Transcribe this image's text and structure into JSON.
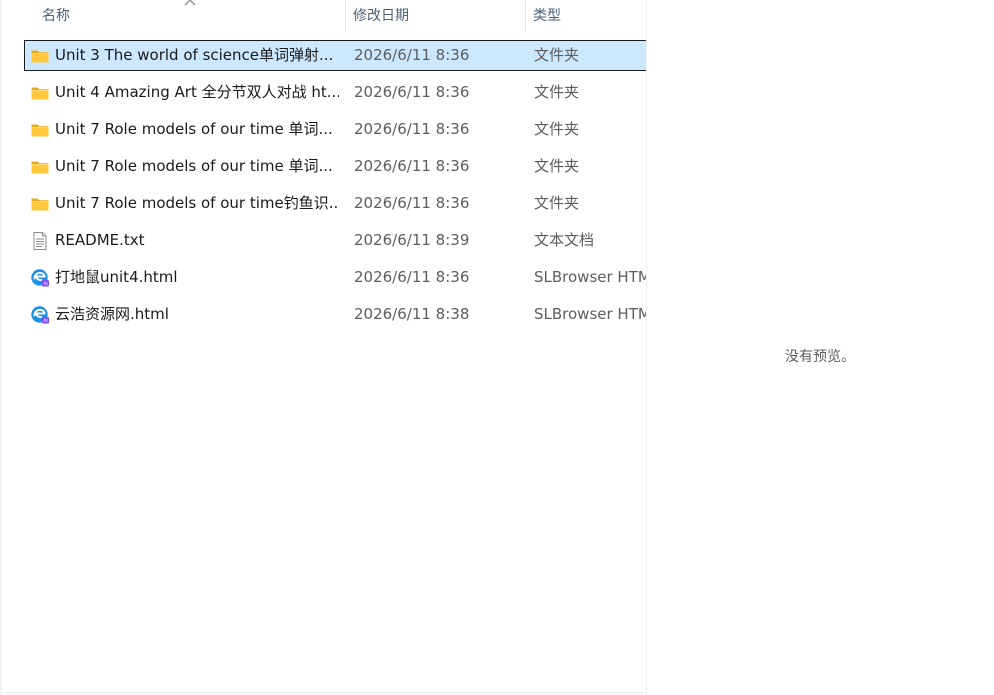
{
  "columns": {
    "name": "名称",
    "modified": "修改日期",
    "type": "类型"
  },
  "files": [
    {
      "name": "Unit 3 The world of science单词弹射...",
      "modified": "2026/6/11 8:36",
      "type": "文件夹",
      "icon": "folder-icon",
      "selected": true
    },
    {
      "name": "Unit 4 Amazing Art  全分节双人对战 ht...",
      "modified": "2026/6/11 8:36",
      "type": "文件夹",
      "icon": "folder-icon",
      "selected": false
    },
    {
      "name": "Unit 7  Role models of our time 单词...",
      "modified": "2026/6/11 8:36",
      "type": "文件夹",
      "icon": "folder-icon",
      "selected": false
    },
    {
      "name": "Unit 7 Role models of our time 单词...",
      "modified": "2026/6/11 8:36",
      "type": "文件夹",
      "icon": "folder-icon",
      "selected": false
    },
    {
      "name": "Unit 7 Role models of our time钓鱼识...",
      "modified": "2026/6/11 8:36",
      "type": "文件夹",
      "icon": "folder-icon",
      "selected": false
    },
    {
      "name": "README.txt",
      "modified": "2026/6/11 8:39",
      "type": "文本文档",
      "icon": "text-file-icon",
      "selected": false
    },
    {
      "name": "打地鼠unit4.html",
      "modified": "2026/6/11 8:36",
      "type": "SLBrowser HTML",
      "icon": "browser-html-icon",
      "selected": false
    },
    {
      "name": "云浩资源网.html",
      "modified": "2026/6/11 8:38",
      "type": "SLBrowser HTML",
      "icon": "browser-html-icon",
      "selected": false
    }
  ],
  "preview": {
    "message": "没有预览。"
  },
  "colors": {
    "selection_bg": "#cce8ff",
    "header_text": "#4c607a",
    "folder_yellow": "#ffc83d",
    "browser_blue": "#1e90e8"
  }
}
